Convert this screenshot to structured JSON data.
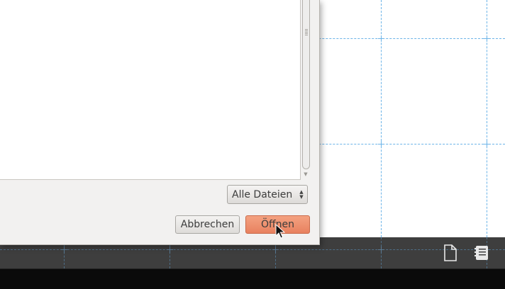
{
  "dialog": {
    "filter": {
      "selected": "Alle Dateien"
    },
    "buttons": {
      "cancel": "Abbrechen",
      "open": "Öffnen"
    }
  },
  "panel": {
    "icons": [
      "new-document-icon",
      "notes-icon"
    ]
  },
  "colors": {
    "grid_line": "#6cb4e8",
    "open_button": "#e8815f",
    "panel_bg": "#3e3e3e"
  }
}
